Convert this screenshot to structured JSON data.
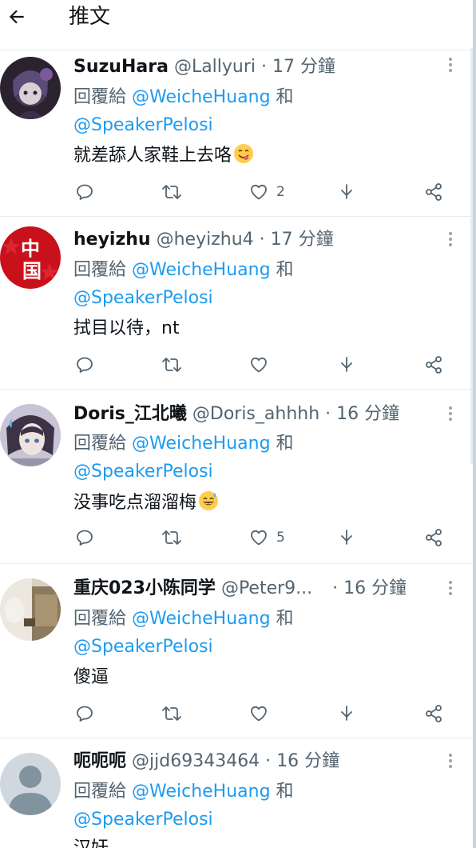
{
  "header": {
    "title": "推文"
  },
  "tweets": [
    {
      "name": "SuzuHara",
      "handle": "@Lallyuri",
      "time": "17 分鐘",
      "reply_prefix": "回覆給 ",
      "reply_mention1": "@WeicheHuang",
      "reply_and": " 和",
      "reply_mention2": "@SpeakerPelosi",
      "text": "就差舔人家鞋上去咯",
      "like_count": "2"
    },
    {
      "name": "heyizhu",
      "handle": "@heyizhu4",
      "time": "17 分鐘",
      "reply_prefix": "回覆給 ",
      "reply_mention1": "@WeicheHuang",
      "reply_and": " 和",
      "reply_mention2": "@SpeakerPelosi",
      "text": "拭目以待，nt",
      "like_count": ""
    },
    {
      "name": "Doris_江北曦",
      "handle": "@Doris_ahhhh",
      "time": "16 分鐘",
      "reply_prefix": "回覆給 ",
      "reply_mention1": "@WeicheHuang",
      "reply_and": " 和",
      "reply_mention2": "@SpeakerPelosi",
      "text": "没事吃点溜溜梅",
      "like_count": "5"
    },
    {
      "name": "重庆023小陈同学",
      "handle": "@Peter9...",
      "time": "16 分鐘",
      "reply_prefix": "回覆給 ",
      "reply_mention1": "@WeicheHuang",
      "reply_and": " 和",
      "reply_mention2": "@SpeakerPelosi",
      "text": "傻逼",
      "like_count": ""
    },
    {
      "name": "呃呃呃",
      "handle": "@jjd69343464",
      "time": "16 分鐘",
      "reply_prefix": "回覆給 ",
      "reply_mention1": "@WeicheHuang",
      "reply_and": " 和",
      "reply_mention2": "@SpeakerPelosi",
      "text": "汉奸",
      "like_count": ""
    }
  ],
  "icons": {
    "back": "arrow-left-icon",
    "more": "more-vertical-icon",
    "reply": "comment-icon",
    "retweet": "retweet-icon",
    "like": "heart-icon",
    "download": "download-icon",
    "share": "share-icon"
  },
  "colors": {
    "text": "#0f1419",
    "secondary": "#536471",
    "link": "#1d9bf0",
    "divider": "#e6ecf0"
  }
}
